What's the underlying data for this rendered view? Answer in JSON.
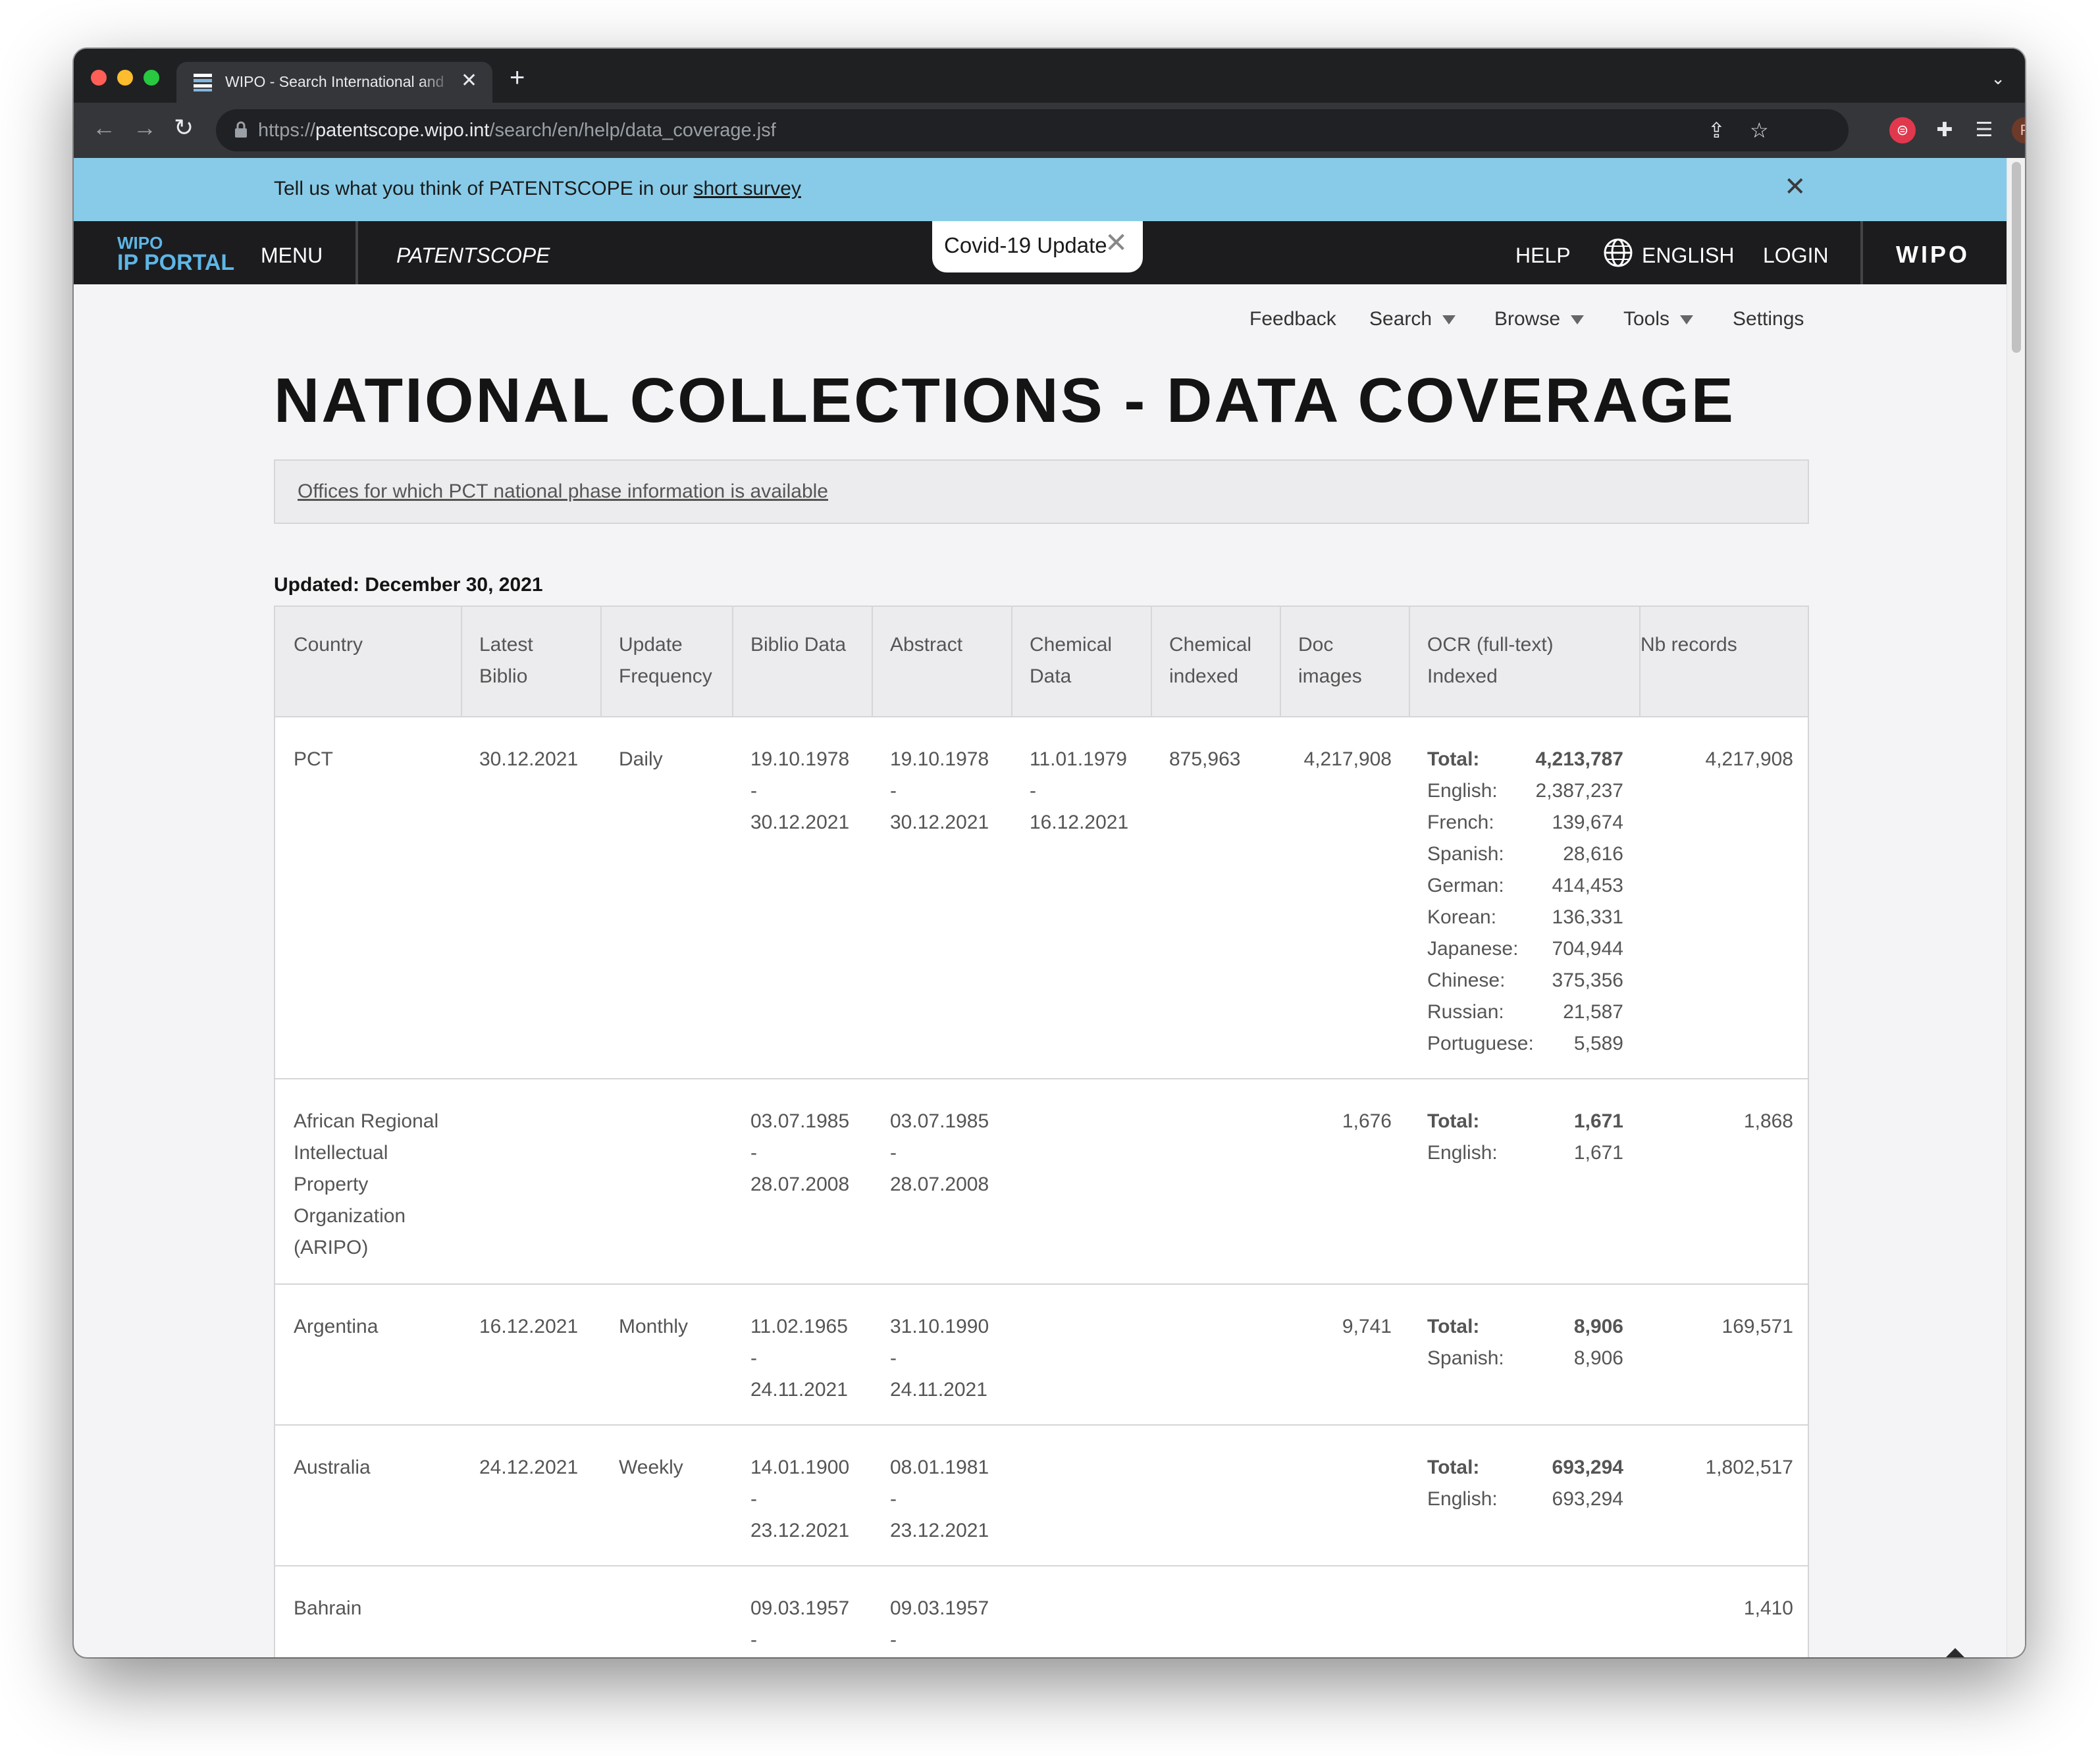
{
  "browser": {
    "tab_title": "WIPO - Search International and National Patent Collections",
    "url_scheme": "https://",
    "url_host": "patentscope.wipo.int",
    "url_path": "/search/en/help/data_coverage.jsf",
    "avatar_letter": "P"
  },
  "survey": {
    "text": "Tell us what you think of PATENTSCOPE in our ",
    "link": "short survey"
  },
  "topnav": {
    "logo_top": "WIPO",
    "logo_bottom": "IP PORTAL",
    "menu": "MENU",
    "product": "PATENTSCOPE",
    "covid": "Covid-19 Update",
    "help": "HELP",
    "language": "ENGLISH",
    "login": "LOGIN",
    "brand": "WIPO"
  },
  "subnav": {
    "feedback": "Feedback",
    "search": "Search",
    "browse": "Browse",
    "tools": "Tools",
    "settings": "Settings"
  },
  "page": {
    "title": "NATIONAL COLLECTIONS - DATA COVERAGE",
    "offices_link": "Offices for which PCT national phase information is available",
    "updated": "Updated: December 30, 2021"
  },
  "table": {
    "headers": [
      "Country",
      "Latest\nBiblio",
      "Update\nFrequency",
      "Biblio Data",
      "Abstract",
      "Chemical\nData",
      "Chemical\nindexed",
      "Doc\nimages",
      "OCR (full-text)\nIndexed",
      "Nb records"
    ],
    "rows": [
      {
        "country": "PCT",
        "latest": "30.12.2021",
        "freq": "Daily",
        "biblio": [
          "19.10.1978",
          "-",
          "30.12.2021"
        ],
        "abstract": [
          "19.10.1978",
          "-",
          "30.12.2021"
        ],
        "chem_data": [
          "11.01.1979",
          "-",
          "16.12.2021"
        ],
        "chem_indexed": "875,963",
        "doc_images": "4,217,908",
        "ocr": [
          [
            "Total:",
            "4,213,787"
          ],
          [
            "English:",
            "2,387,237"
          ],
          [
            "French:",
            "139,674"
          ],
          [
            "Spanish:",
            "28,616"
          ],
          [
            "German:",
            "414,453"
          ],
          [
            "Korean:",
            "136,331"
          ],
          [
            "Japanese:",
            "704,944"
          ],
          [
            "Chinese:",
            "375,356"
          ],
          [
            "Russian:",
            "21,587"
          ],
          [
            "Portuguese:",
            "5,589"
          ]
        ],
        "nb_records": "4,217,908"
      },
      {
        "country": "African Regional Intellectual Property Organization (ARIPO)",
        "latest": "",
        "freq": "",
        "biblio": [
          "03.07.1985",
          "-",
          "28.07.2008"
        ],
        "abstract": [
          "03.07.1985",
          "-",
          "28.07.2008"
        ],
        "chem_data": [],
        "chem_indexed": "",
        "doc_images": "1,676",
        "ocr": [
          [
            "Total:",
            "1,671"
          ],
          [
            "English:",
            "1,671"
          ]
        ],
        "nb_records": "1,868"
      },
      {
        "country": "Argentina",
        "latest": "16.12.2021",
        "freq": "Monthly",
        "biblio": [
          "11.02.1965",
          "-",
          "24.11.2021"
        ],
        "abstract": [
          "31.10.1990",
          "-",
          "24.11.2021"
        ],
        "chem_data": [],
        "chem_indexed": "",
        "doc_images": "9,741",
        "ocr": [
          [
            "Total:",
            "8,906"
          ],
          [
            "Spanish:",
            "8,906"
          ]
        ],
        "nb_records": "169,571"
      },
      {
        "country": "Australia",
        "latest": "24.12.2021",
        "freq": "Weekly",
        "biblio": [
          "14.01.1900",
          "-",
          "23.12.2021"
        ],
        "abstract": [
          "08.01.1981",
          "-",
          "23.12.2021"
        ],
        "chem_data": [],
        "chem_indexed": "",
        "doc_images": "",
        "ocr": [
          [
            "Total:",
            "693,294"
          ],
          [
            "English:",
            "693,294"
          ]
        ],
        "nb_records": "1,802,517"
      },
      {
        "country": "Bahrain",
        "latest": "",
        "freq": "",
        "biblio": [
          "09.03.1957",
          "-"
        ],
        "abstract": [
          "09.03.1957",
          "-"
        ],
        "chem_data": [],
        "chem_indexed": "",
        "doc_images": "",
        "ocr": [],
        "nb_records": "1,410"
      }
    ]
  },
  "icons": {
    "scroll_top": "arrow-up-icon",
    "globe": "globe-icon",
    "lock": "lock-icon"
  },
  "colors": {
    "survey_bg": "#87cbe8",
    "nav_bg": "#1c1c1e",
    "logo_blue": "#5eb6e6"
  }
}
